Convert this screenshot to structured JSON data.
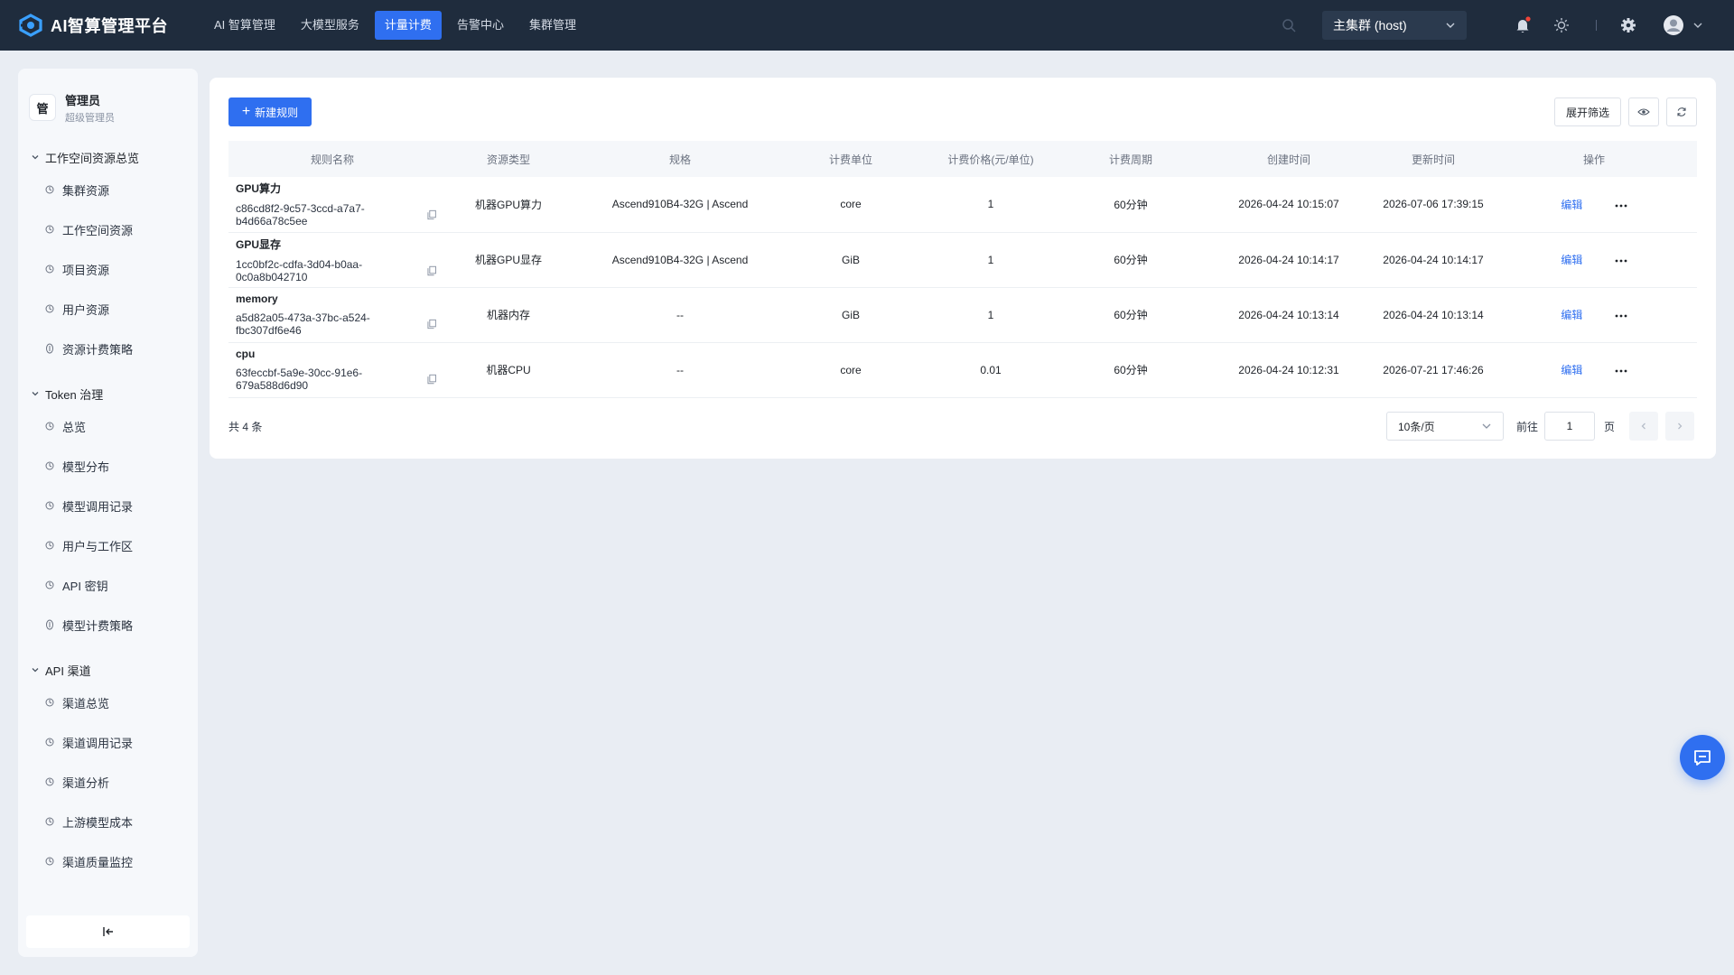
{
  "app": {
    "title": "AI智算管理平台"
  },
  "nav": [
    {
      "label": "AI 智算管理",
      "active": false
    },
    {
      "label": "大模型服务",
      "active": false
    },
    {
      "label": "计量计费",
      "active": true
    },
    {
      "label": "告警中心",
      "active": false
    },
    {
      "label": "集群管理",
      "active": false
    }
  ],
  "header": {
    "cluster": "主集群 (host)"
  },
  "user": {
    "avatar_text": "管",
    "name": "管理员",
    "role": "超级管理员"
  },
  "sidebar": {
    "groups": [
      {
        "title": "工作空间资源总览",
        "items": [
          "集群资源",
          "工作空间资源",
          "项目资源",
          "用户资源",
          "资源计费策略"
        ]
      },
      {
        "title": "Token 治理",
        "items": [
          "总览",
          "模型分布",
          "模型调用记录",
          "用户与工作区",
          "API 密钥",
          "模型计费策略"
        ]
      },
      {
        "title": "API 渠道",
        "items": [
          "渠道总览",
          "渠道调用记录",
          "渠道分析",
          "上游模型成本",
          "渠道质量监控"
        ]
      }
    ]
  },
  "toolbar": {
    "new_rule": "新建规则",
    "expand_filter": "展开筛选"
  },
  "table": {
    "columns": [
      "规则名称",
      "资源类型",
      "规格",
      "计费单位",
      "计费价格(元/单位)",
      "计费周期",
      "创建时间",
      "更新时间",
      "操作"
    ],
    "edit_label": "编辑",
    "rows": [
      {
        "name": "GPU算力",
        "id": "c86cd8f2-9c57-3ccd-a7a7-b4d66a78c5ee",
        "resource_type": "机器GPU算力",
        "spec": "Ascend910B4-32G | Ascend",
        "unit": "core",
        "price": "1",
        "period": "60分钟",
        "created": "2026-04-24 10:15:07",
        "updated": "2026-07-06 17:39:15"
      },
      {
        "name": "GPU显存",
        "id": "1cc0bf2c-cdfa-3d04-b0aa-0c0a8b042710",
        "resource_type": "机器GPU显存",
        "spec": "Ascend910B4-32G | Ascend",
        "unit": "GiB",
        "price": "1",
        "period": "60分钟",
        "created": "2026-04-24 10:14:17",
        "updated": "2026-04-24 10:14:17"
      },
      {
        "name": "memory",
        "id": "a5d82a05-473a-37bc-a524-fbc307df6e46",
        "resource_type": "机器内存",
        "spec": "--",
        "unit": "GiB",
        "price": "1",
        "period": "60分钟",
        "created": "2026-04-24 10:13:14",
        "updated": "2026-04-24 10:13:14"
      },
      {
        "name": "cpu",
        "id": "63feccbf-5a9e-30cc-91e6-679a588d6d90",
        "resource_type": "机器CPU",
        "spec": "--",
        "unit": "core",
        "price": "0.01",
        "period": "60分钟",
        "created": "2026-04-24 10:12:31",
        "updated": "2026-07-21 17:46:26"
      }
    ]
  },
  "pagination": {
    "total": "共 4 条",
    "page_size": "10条/页",
    "goto": "前往",
    "page": "1",
    "unit": "页"
  },
  "colors": {
    "topbar": "#1f2c3d",
    "accent": "#2f6ff0",
    "background": "#e9edf3"
  }
}
